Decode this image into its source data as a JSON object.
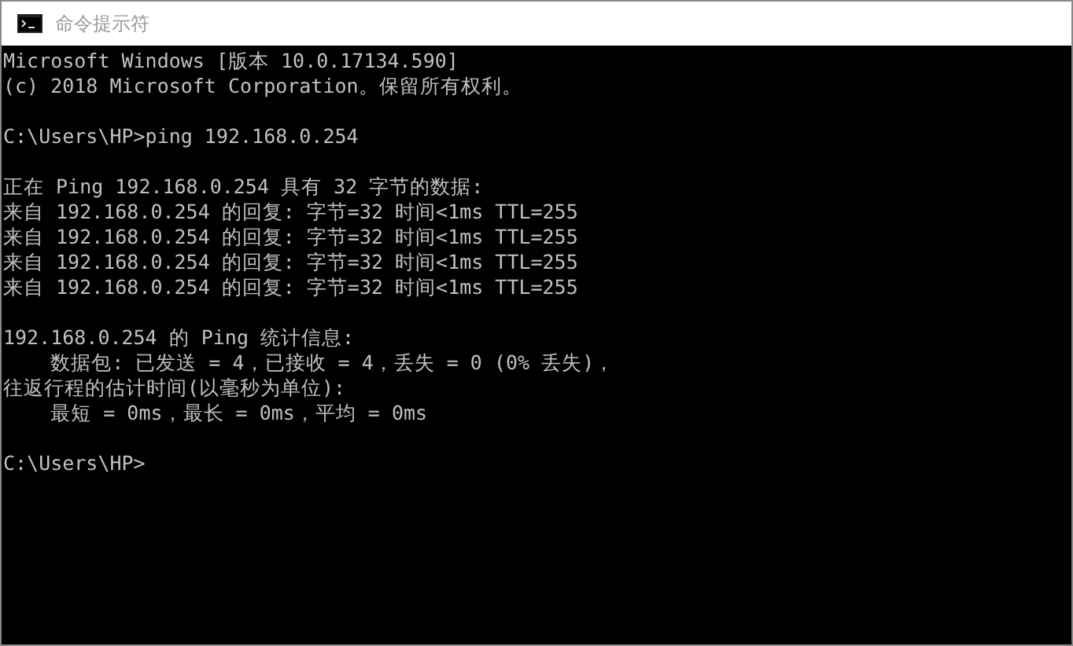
{
  "window": {
    "title": "命令提示符"
  },
  "console": {
    "blocks": [
      [
        "Microsoft Windows [版本 10.0.17134.590]",
        "(c) 2018 Microsoft Corporation。保留所有权利。"
      ],
      [
        "C:\\Users\\HP>ping 192.168.0.254"
      ],
      [
        "正在 Ping 192.168.0.254 具有 32 字节的数据:",
        "来自 192.168.0.254 的回复: 字节=32 时间<1ms TTL=255",
        "来自 192.168.0.254 的回复: 字节=32 时间<1ms TTL=255",
        "来自 192.168.0.254 的回复: 字节=32 时间<1ms TTL=255",
        "来自 192.168.0.254 的回复: 字节=32 时间<1ms TTL=255"
      ],
      [
        "192.168.0.254 的 Ping 统计信息:",
        "    数据包: 已发送 = 4，已接收 = 4，丢失 = 0 (0% 丢失)，",
        "往返行程的估计时间(以毫秒为单位):",
        "    最短 = 0ms，最长 = 0ms，平均 = 0ms"
      ],
      [
        "C:\\Users\\HP>"
      ]
    ]
  }
}
